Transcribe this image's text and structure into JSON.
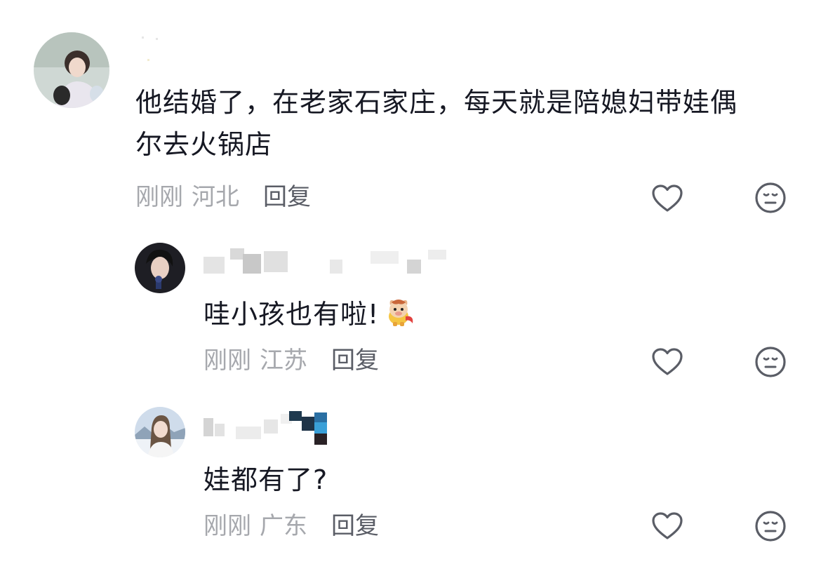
{
  "comments": [
    {
      "text_line1": "他结婚了，在老家石家庄，每天就是陪媳妇带娃偶",
      "text_line2": "尔去火锅店",
      "time": "刚刚",
      "location": "河北",
      "reply_label": "回复"
    },
    {
      "text": "哇小孩也有啦!",
      "sticker": "horse-sticker",
      "time": "刚刚",
      "location": "江苏",
      "reply_label": "回复"
    },
    {
      "text": "娃都有了?",
      "time": "刚刚",
      "location": "广东",
      "reply_label": "回复"
    }
  ],
  "icons": {
    "like": "heart-outline-icon",
    "dislike": "meh-face-icon"
  },
  "colors": {
    "text": "#161823",
    "meta": "#a6a8ad",
    "reply": "#5a5d66",
    "icon": "#5a5d66"
  }
}
